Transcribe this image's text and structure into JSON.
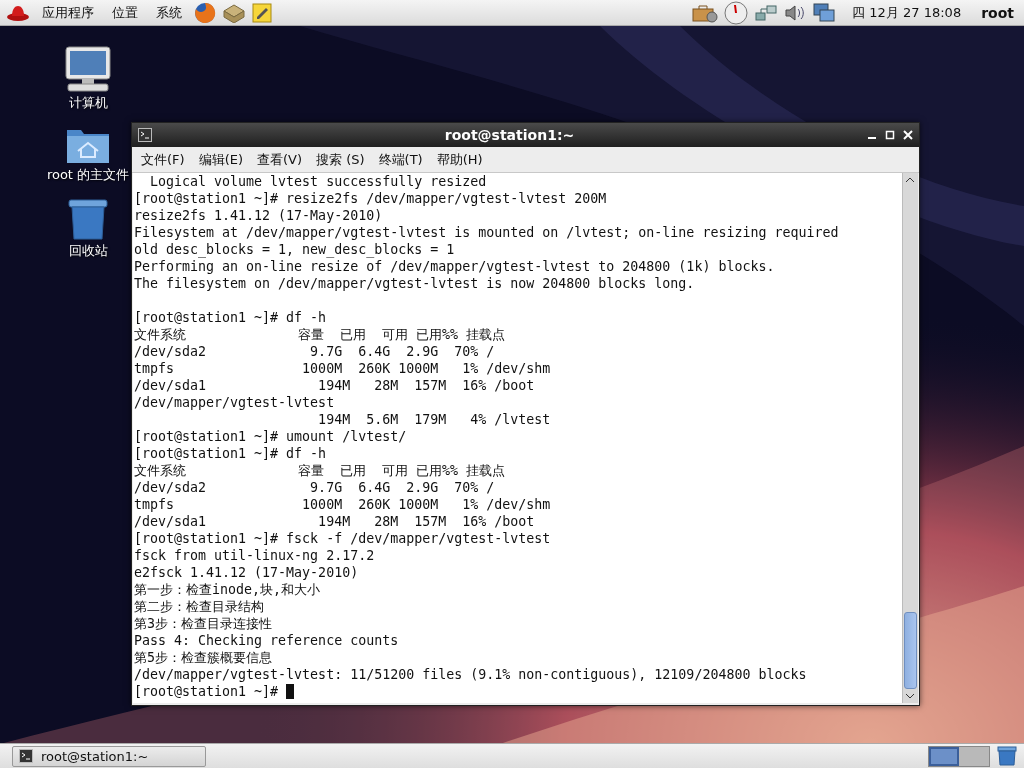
{
  "top_panel": {
    "menus": [
      "应用程序",
      "位置",
      "系统"
    ],
    "clock": "四 12月 27 18:08",
    "user": "root"
  },
  "desktop_icons": [
    {
      "kind": "computer",
      "label": "计算机"
    },
    {
      "kind": "home",
      "label": "root 的主文件"
    },
    {
      "kind": "trash",
      "label": "回收站"
    }
  ],
  "terminal": {
    "title": "root@station1:~",
    "menu": [
      "文件(F)",
      "编辑(E)",
      "查看(V)",
      "搜索 (S)",
      "终端(T)",
      "帮助(H)"
    ],
    "sections": [
      {
        "lines": [
          "  Logical volume lvtest successfully resized",
          "[root@station1 ~]# resize2fs /dev/mapper/vgtest-lvtest 200M",
          "resize2fs 1.41.12 (17-May-2010)",
          "Filesystem at /dev/mapper/vgtest-lvtest is mounted on /lvtest; on-line resizing required",
          "old desc_blocks = 1, new_desc_blocks = 1",
          "Performing an on-line resize of /dev/mapper/vgtest-lvtest to 204800 (1k) blocks.",
          "The filesystem on /dev/mapper/vgtest-lvtest is now 204800 blocks long."
        ]
      },
      {
        "lines": [
          "[root@station1 ~]# df -h",
          "文件系统              容量  已用  可用 已用%% 挂载点",
          "/dev/sda2             9.7G  6.4G  2.9G  70% /",
          "tmpfs                1000M  260K 1000M   1% /dev/shm",
          "/dev/sda1              194M   28M  157M  16% /boot",
          "/dev/mapper/vgtest-lvtest",
          "                       194M  5.6M  179M   4% /lvtest",
          "[root@station1 ~]# umount /lvtest/",
          "[root@station1 ~]# df -h",
          "文件系统              容量  已用  可用 已用%% 挂载点",
          "/dev/sda2             9.7G  6.4G  2.9G  70% /",
          "tmpfs                1000M  260K 1000M   1% /dev/shm",
          "/dev/sda1              194M   28M  157M  16% /boot",
          "[root@station1 ~]# fsck -f /dev/mapper/vgtest-lvtest",
          "fsck from util-linux-ng 2.17.2",
          "e2fsck 1.41.12 (17-May-2010)",
          "第一步：检查inode,块,和大小",
          "第二步：检查目录结构",
          "第3步：检查目录连接性",
          "Pass 4: Checking reference counts",
          "第5步：检查簇概要信息",
          "/dev/mapper/vgtest-lvtest: 11/51200 files (9.1% non-contiguous), 12109/204800 blocks",
          "[root@station1 ~]# "
        ]
      }
    ],
    "cursor": true
  },
  "bottom_panel": {
    "tasks": [
      {
        "label": "root@station1:~",
        "selected": false
      }
    ],
    "workspaces": [
      {
        "selected": true
      },
      {
        "selected": false
      }
    ]
  }
}
